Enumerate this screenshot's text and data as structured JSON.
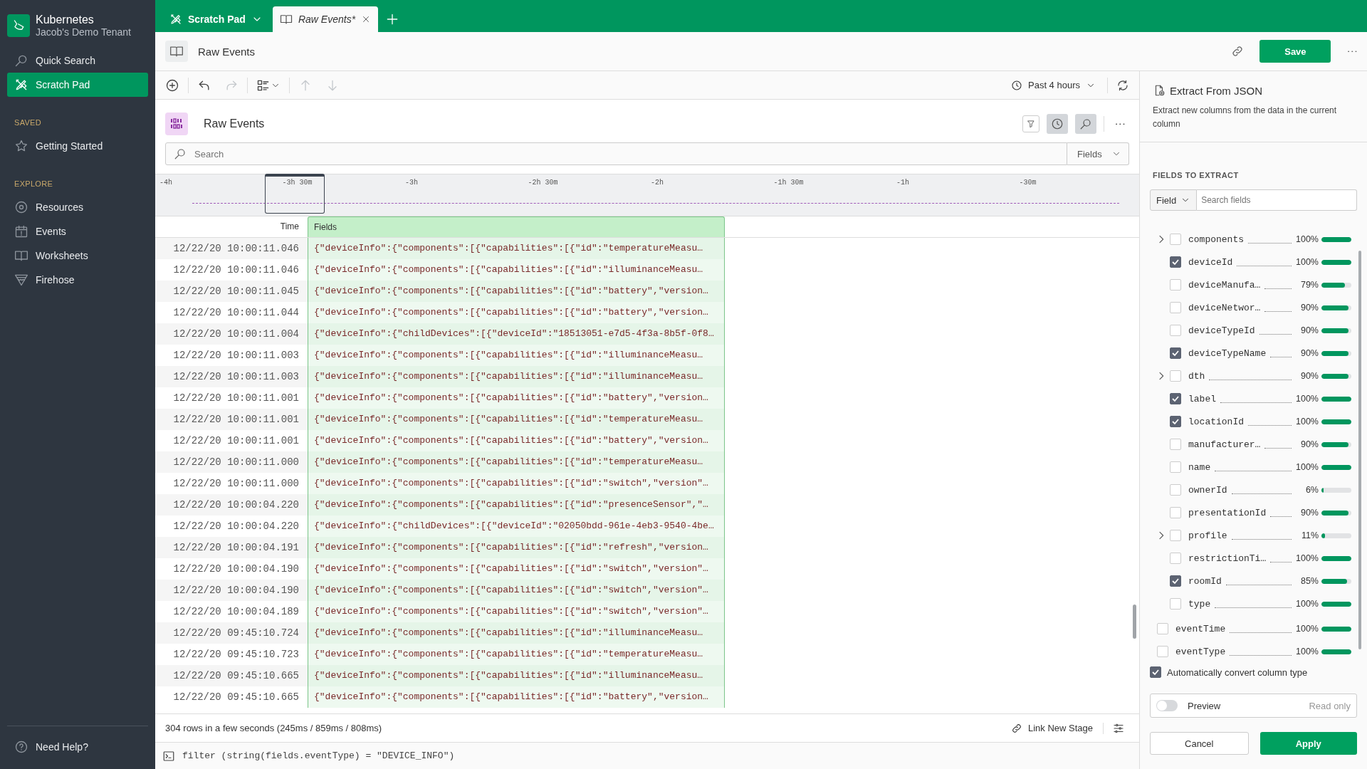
{
  "sidebar": {
    "brand": {
      "title": "Kubernetes",
      "subtitle": "Jacob's Demo Tenant"
    },
    "items": [
      {
        "label": "Quick Search",
        "kind": "search",
        "selected": false
      },
      {
        "label": "Scratch Pad",
        "kind": "scratch",
        "selected": true
      }
    ],
    "sections": [
      {
        "title": "SAVED",
        "items": [
          {
            "label": "Getting Started",
            "kind": "star",
            "selected": false
          }
        ]
      },
      {
        "title": "EXPLORE",
        "items": [
          {
            "label": "Resources",
            "kind": "target",
            "selected": false
          },
          {
            "label": "Events",
            "kind": "calendar",
            "selected": false
          },
          {
            "label": "Worksheets",
            "kind": "book",
            "selected": false
          },
          {
            "label": "Firehose",
            "kind": "funnel",
            "selected": false
          }
        ]
      }
    ],
    "help": {
      "label": "Need Help?"
    }
  },
  "tabs": [
    {
      "label": "Scratch Pad",
      "kind": "scratch",
      "selected": false
    },
    {
      "label": "Raw Events*",
      "kind": "book",
      "selected": true
    }
  ],
  "header": {
    "title": "Raw Events",
    "save": "Save"
  },
  "toolbar": {
    "tools": [
      {
        "kind": "add",
        "disabled": false
      },
      {
        "kind": "undo",
        "disabled": false
      },
      {
        "kind": "redo",
        "disabled": true
      },
      {
        "kind": "layout",
        "disabled": false
      },
      {
        "kind": "up",
        "disabled": true
      },
      {
        "kind": "down",
        "disabled": true
      }
    ],
    "time_range": "Past 4 hours"
  },
  "stage": {
    "title": "Raw Events",
    "filter_active": false,
    "time_active": true,
    "search_active": true,
    "search": {
      "placeholder": "Search"
    },
    "fields_menu": "Fields",
    "timeline": {
      "ticks": [
        "-4h",
        "-3h 30m",
        "-3h",
        "-2h 30m",
        "-2h",
        "-1h 30m",
        "-1h",
        "-30m"
      ]
    },
    "table": {
      "columns": [
        "Time",
        "Fields"
      ],
      "rows": [
        [
          "12/22/20 10:00:11.046",
          "{\"deviceInfo\":{\"components\":[{\"capabilities\":[{\"id\":\"temperatureMeasu…"
        ],
        [
          "12/22/20 10:00:11.046",
          "{\"deviceInfo\":{\"components\":[{\"capabilities\":[{\"id\":\"illuminanceMeasu…"
        ],
        [
          "12/22/20 10:00:11.045",
          "{\"deviceInfo\":{\"components\":[{\"capabilities\":[{\"id\":\"battery\",\"version…"
        ],
        [
          "12/22/20 10:00:11.044",
          "{\"deviceInfo\":{\"components\":[{\"capabilities\":[{\"id\":\"battery\",\"version…"
        ],
        [
          "12/22/20 10:00:11.004",
          "{\"deviceInfo\":{\"childDevices\":[{\"deviceId\":\"18513051-e7d5-4f3a-8b5f-0f8…"
        ],
        [
          "12/22/20 10:00:11.003",
          "{\"deviceInfo\":{\"components\":[{\"capabilities\":[{\"id\":\"illuminanceMeasu…"
        ],
        [
          "12/22/20 10:00:11.003",
          "{\"deviceInfo\":{\"components\":[{\"capabilities\":[{\"id\":\"illuminanceMeasu…"
        ],
        [
          "12/22/20 10:00:11.001",
          "{\"deviceInfo\":{\"components\":[{\"capabilities\":[{\"id\":\"battery\",\"version…"
        ],
        [
          "12/22/20 10:00:11.001",
          "{\"deviceInfo\":{\"components\":[{\"capabilities\":[{\"id\":\"temperatureMeasu…"
        ],
        [
          "12/22/20 10:00:11.001",
          "{\"deviceInfo\":{\"components\":[{\"capabilities\":[{\"id\":\"battery\",\"version…"
        ],
        [
          "12/22/20 10:00:11.000",
          "{\"deviceInfo\":{\"components\":[{\"capabilities\":[{\"id\":\"temperatureMeasu…"
        ],
        [
          "12/22/20 10:00:11.000",
          "{\"deviceInfo\":{\"components\":[{\"capabilities\":[{\"id\":\"switch\",\"version\"…"
        ],
        [
          "12/22/20 10:00:04.220",
          "{\"deviceInfo\":{\"components\":[{\"capabilities\":[{\"id\":\"presenceSensor\",\"…"
        ],
        [
          "12/22/20 10:00:04.220",
          "{\"deviceInfo\":{\"childDevices\":[{\"deviceId\":\"02050bdd-961e-4eb3-9540-4be…"
        ],
        [
          "12/22/20 10:00:04.191",
          "{\"deviceInfo\":{\"components\":[{\"capabilities\":[{\"id\":\"refresh\",\"version…"
        ],
        [
          "12/22/20 10:00:04.190",
          "{\"deviceInfo\":{\"components\":[{\"capabilities\":[{\"id\":\"switch\",\"version\"…"
        ],
        [
          "12/22/20 10:00:04.190",
          "{\"deviceInfo\":{\"components\":[{\"capabilities\":[{\"id\":\"switch\",\"version\"…"
        ],
        [
          "12/22/20 10:00:04.189",
          "{\"deviceInfo\":{\"components\":[{\"capabilities\":[{\"id\":\"switch\",\"version\"…"
        ],
        [
          "12/22/20 09:45:10.724",
          "{\"deviceInfo\":{\"components\":[{\"capabilities\":[{\"id\":\"illuminanceMeasu…"
        ],
        [
          "12/22/20 09:45:10.723",
          "{\"deviceInfo\":{\"components\":[{\"capabilities\":[{\"id\":\"temperatureMeasu…"
        ],
        [
          "12/22/20 09:45:10.665",
          "{\"deviceInfo\":{\"components\":[{\"capabilities\":[{\"id\":\"illuminanceMeasu…"
        ],
        [
          "12/22/20 09:45:10.665",
          "{\"deviceInfo\":{\"components\":[{\"capabilities\":[{\"id\":\"battery\",\"version…"
        ]
      ]
    },
    "status": "304 rows in a few seconds (245ms / 859ms / 808ms)",
    "link_stage": "Link New Stage",
    "filter": "filter (string(fields.eventType) = \"DEVICE_INFO\")"
  },
  "panel": {
    "title": "Extract From JSON",
    "description": "Extract new columns from the data in the current column",
    "section": "FIELDS TO EXTRACT",
    "field_menu": "Field",
    "search": {
      "placeholder": "Search fields"
    },
    "fields": [
      {
        "kind": "group",
        "children": [
          {
            "name": "components",
            "percent": "100%",
            "level": 1.0,
            "checked": false,
            "expandable": true
          },
          {
            "name": "deviceId",
            "percent": "100%",
            "level": 1.0,
            "checked": true,
            "expandable": false
          },
          {
            "name": "deviceManufa…",
            "percent": "79%",
            "level": 0.79,
            "checked": false,
            "expandable": false
          },
          {
            "name": "deviceNetwor…",
            "percent": "90%",
            "level": 0.9,
            "checked": false,
            "expandable": false
          },
          {
            "name": "deviceTypeId",
            "percent": "90%",
            "level": 0.9,
            "checked": false,
            "expandable": false
          },
          {
            "name": "deviceTypeName",
            "percent": "90%",
            "level": 0.9,
            "checked": true,
            "expandable": false
          },
          {
            "name": "dth",
            "percent": "90%",
            "level": 0.9,
            "checked": false,
            "expandable": true
          },
          {
            "name": "label",
            "percent": "100%",
            "level": 1.0,
            "checked": true,
            "expandable": false
          },
          {
            "name": "locationId",
            "percent": "100%",
            "level": 1.0,
            "checked": true,
            "expandable": false
          },
          {
            "name": "manufacturer…",
            "percent": "90%",
            "level": 0.9,
            "checked": false,
            "expandable": false
          },
          {
            "name": "name",
            "percent": "100%",
            "level": 1.0,
            "checked": false,
            "expandable": false
          },
          {
            "name": "ownerId",
            "percent": "6%",
            "level": 0.06,
            "checked": false,
            "expandable": false
          },
          {
            "name": "presentationId",
            "percent": "90%",
            "level": 0.9,
            "checked": false,
            "expandable": false
          },
          {
            "name": "profile",
            "percent": "11%",
            "level": 0.11,
            "checked": false,
            "expandable": true
          },
          {
            "name": "restrictionTi…",
            "percent": "100%",
            "level": 1.0,
            "checked": false,
            "expandable": false
          },
          {
            "name": "roomId",
            "percent": "85%",
            "level": 0.85,
            "checked": true,
            "expandable": false
          },
          {
            "name": "type",
            "percent": "100%",
            "level": 1.0,
            "checked": false,
            "expandable": false
          }
        ]
      },
      {
        "kind": "field",
        "name": "eventTime",
        "percent": "100%",
        "level": 1.0,
        "checked": false,
        "expandable": false
      },
      {
        "kind": "field",
        "name": "eventType",
        "percent": "100%",
        "level": 1.0,
        "checked": false,
        "expandable": false
      }
    ],
    "auto_convert": {
      "label": "Automatically convert column type",
      "checked": true
    },
    "preview": {
      "label": "Preview",
      "on": false,
      "note": "Read only"
    },
    "buttons": {
      "cancel": "Cancel",
      "apply": "Apply"
    }
  }
}
